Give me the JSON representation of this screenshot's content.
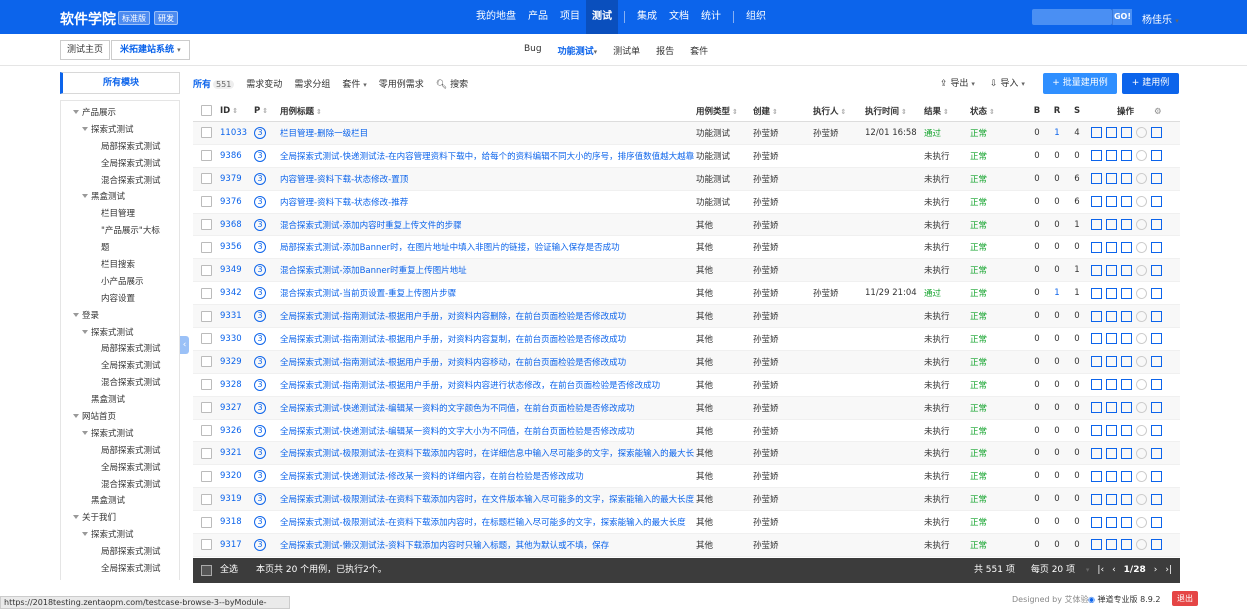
{
  "app": {
    "brand": "软件学院",
    "badges": [
      "标准版",
      "研发"
    ],
    "nav": [
      "我的地盘",
      "产品",
      "项目",
      "测试",
      "集成",
      "文档",
      "统计",
      "组织"
    ],
    "go_label": "GO!",
    "user": "杨佳乐"
  },
  "subbar": {
    "crumb_home": "测试主页",
    "crumb_product": "米拓建站系统",
    "tabs": [
      "Bug",
      "功能测试",
      "测试单",
      "报告",
      "套件"
    ]
  },
  "sidebar": {
    "title": "所有模块",
    "tree": [
      {
        "level": 0,
        "label": "产品展示",
        "expand": true
      },
      {
        "level": 1,
        "label": "探索式测试",
        "expand": true
      },
      {
        "level": 2,
        "label": "局部探索式测试"
      },
      {
        "level": 2,
        "label": "全局探索式测试"
      },
      {
        "level": 2,
        "label": "混合探索式测试"
      },
      {
        "level": 1,
        "label": "黑盒测试",
        "expand": true
      },
      {
        "level": 2,
        "label": "栏目管理"
      },
      {
        "level": 2,
        "label": "\"产品展示\"大标"
      },
      {
        "level": 2,
        "label": "题"
      },
      {
        "level": 2,
        "label": "栏目搜索"
      },
      {
        "level": 2,
        "label": "小产品展示"
      },
      {
        "level": 2,
        "label": "内容设置"
      },
      {
        "level": 0,
        "label": "登录",
        "expand": true
      },
      {
        "level": 1,
        "label": "探索式测试",
        "expand": true
      },
      {
        "level": 2,
        "label": "局部探索式测试"
      },
      {
        "level": 2,
        "label": "全局探索式测试"
      },
      {
        "level": 2,
        "label": "混合探索式测试"
      },
      {
        "level": 3,
        "label": "黑盒测试"
      },
      {
        "level": 0,
        "label": "网站首页",
        "expand": true
      },
      {
        "level": 1,
        "label": "探索式测试",
        "expand": true
      },
      {
        "level": 2,
        "label": "局部探索式测试"
      },
      {
        "level": 2,
        "label": "全局探索式测试"
      },
      {
        "level": 2,
        "label": "混合探索式测试"
      },
      {
        "level": 3,
        "label": "黑盒测试"
      },
      {
        "level": 0,
        "label": "关于我们",
        "expand": true
      },
      {
        "level": 1,
        "label": "探索式测试",
        "expand": true
      },
      {
        "level": 2,
        "label": "局部探索式测试"
      },
      {
        "level": 2,
        "label": "全局探索式测试"
      },
      {
        "level": 2,
        "label": "混合探索式测试"
      }
    ]
  },
  "toolbar": {
    "tabs": [
      {
        "label": "所有",
        "count": "551"
      },
      {
        "label": "需求变动"
      },
      {
        "label": "需求分组"
      },
      {
        "label": "套件",
        "dropdown": true
      },
      {
        "label": "零用例需求"
      },
      {
        "label": "搜索",
        "icon": "search-icon"
      }
    ],
    "export_label": "导出",
    "import_label": "导入",
    "batch_label": "+ 批量建用例",
    "new_label": "+ 建用例"
  },
  "table": {
    "headers": {
      "id": "ID",
      "p": "P",
      "title": "用例标题",
      "type": "用例类型",
      "creator": "创建",
      "executor": "执行人",
      "time": "执行时间",
      "result": "结果",
      "status": "状态",
      "b": "B",
      "r": "R",
      "s": "S",
      "ops": "操作"
    },
    "rows": [
      {
        "id": "11033",
        "p": "3",
        "title": "栏目管理-删除一级栏目",
        "type": "功能测试",
        "creator": "孙莹娇",
        "executor": "孙莹娇",
        "time": "12/01 16:58",
        "result": "通过",
        "status": "正常",
        "b": "0",
        "r": "1",
        "s": "4"
      },
      {
        "id": "9386",
        "p": "3",
        "title": "全局探索式测试-快递测试法-在内容管理资料下载中，给每个的资料编辑不同大小的序号，排序值数值越大越靠",
        "type": "功能测试",
        "creator": "孙莹娇",
        "executor": "",
        "time": "",
        "result": "未执行",
        "status": "正常",
        "b": "0",
        "r": "0",
        "s": "0"
      },
      {
        "id": "9379",
        "p": "3",
        "title": "内容管理-资料下载-状态修改-置顶",
        "type": "功能测试",
        "creator": "孙莹娇",
        "executor": "",
        "time": "",
        "result": "未执行",
        "status": "正常",
        "b": "0",
        "r": "0",
        "s": "6"
      },
      {
        "id": "9376",
        "p": "3",
        "title": "内容管理-资料下载-状态修改-推荐",
        "type": "功能测试",
        "creator": "孙莹娇",
        "executor": "",
        "time": "",
        "result": "未执行",
        "status": "正常",
        "b": "0",
        "r": "0",
        "s": "6"
      },
      {
        "id": "9368",
        "p": "3",
        "title": "混合探索式测试-添加内容时重复上传文件的步骤",
        "type": "其他",
        "creator": "孙莹娇",
        "executor": "",
        "time": "",
        "result": "未执行",
        "status": "正常",
        "b": "0",
        "r": "0",
        "s": "1"
      },
      {
        "id": "9356",
        "p": "3",
        "title": "局部探索式测试-添加Banner时，在图片地址中填入非图片的链接，验证输入保存是否成功",
        "type": "其他",
        "creator": "孙莹娇",
        "executor": "",
        "time": "",
        "result": "未执行",
        "status": "正常",
        "b": "0",
        "r": "0",
        "s": "0"
      },
      {
        "id": "9349",
        "p": "3",
        "title": "混合探索式测试-添加Banner时重复上传图片地址",
        "type": "其他",
        "creator": "孙莹娇",
        "executor": "",
        "time": "",
        "result": "未执行",
        "status": "正常",
        "b": "0",
        "r": "0",
        "s": "1"
      },
      {
        "id": "9342",
        "p": "3",
        "title": "混合探索式测试-当前页设置-重复上传图片步骤",
        "type": "其他",
        "creator": "孙莹娇",
        "executor": "孙莹娇",
        "time": "11/29 21:04",
        "result": "通过",
        "status": "正常",
        "b": "0",
        "r": "1",
        "s": "1"
      },
      {
        "id": "9331",
        "p": "3",
        "title": "全局探索式测试-指南测试法-根据用户手册，对资料内容删除，在前台页面检验是否修改成功",
        "type": "其他",
        "creator": "孙莹娇",
        "executor": "",
        "time": "",
        "result": "未执行",
        "status": "正常",
        "b": "0",
        "r": "0",
        "s": "0"
      },
      {
        "id": "9330",
        "p": "3",
        "title": "全局探索式测试-指南测试法-根据用户手册，对资料内容复制，在前台页面检验是否修改成功",
        "type": "其他",
        "creator": "孙莹娇",
        "executor": "",
        "time": "",
        "result": "未执行",
        "status": "正常",
        "b": "0",
        "r": "0",
        "s": "0"
      },
      {
        "id": "9329",
        "p": "3",
        "title": "全局探索式测试-指南测试法-根据用户手册，对资料内容移动，在前台页面检验是否修改成功",
        "type": "其他",
        "creator": "孙莹娇",
        "executor": "",
        "time": "",
        "result": "未执行",
        "status": "正常",
        "b": "0",
        "r": "0",
        "s": "0"
      },
      {
        "id": "9328",
        "p": "3",
        "title": "全局探索式测试-指南测试法-根据用户手册，对资料内容进行状态修改，在前台页面检验是否修改成功",
        "type": "其他",
        "creator": "孙莹娇",
        "executor": "",
        "time": "",
        "result": "未执行",
        "status": "正常",
        "b": "0",
        "r": "0",
        "s": "0"
      },
      {
        "id": "9327",
        "p": "3",
        "title": "全局探索式测试-快递测试法-编辑某一资料的文字颜色为不同值，在前台页面检验是否修改成功",
        "type": "其他",
        "creator": "孙莹娇",
        "executor": "",
        "time": "",
        "result": "未执行",
        "status": "正常",
        "b": "0",
        "r": "0",
        "s": "0"
      },
      {
        "id": "9326",
        "p": "3",
        "title": "全局探索式测试-快递测试法-编辑某一资料的文字大小为不同值，在前台页面检验是否修改成功",
        "type": "其他",
        "creator": "孙莹娇",
        "executor": "",
        "time": "",
        "result": "未执行",
        "status": "正常",
        "b": "0",
        "r": "0",
        "s": "0"
      },
      {
        "id": "9321",
        "p": "3",
        "title": "全局探索式测试-极限测试法-在资料下载添加内容时，在详细信息中输入尽可能多的文字，探索能输入的最大长",
        "type": "其他",
        "creator": "孙莹娇",
        "executor": "",
        "time": "",
        "result": "未执行",
        "status": "正常",
        "b": "0",
        "r": "0",
        "s": "0"
      },
      {
        "id": "9320",
        "p": "3",
        "title": "全局探索式测试-快递测试法-修改某一资料的详细内容，在前台检验是否修改成功",
        "type": "其他",
        "creator": "孙莹娇",
        "executor": "",
        "time": "",
        "result": "未执行",
        "status": "正常",
        "b": "0",
        "r": "0",
        "s": "0"
      },
      {
        "id": "9319",
        "p": "3",
        "title": "全局探索式测试-极限测试法-在资料下载添加内容时，在文件版本输入尽可能多的文字，探索能输入的最大长度",
        "type": "其他",
        "creator": "孙莹娇",
        "executor": "",
        "time": "",
        "result": "未执行",
        "status": "正常",
        "b": "0",
        "r": "0",
        "s": "0"
      },
      {
        "id": "9318",
        "p": "3",
        "title": "全局探索式测试-极限测试法-在资料下载添加内容时，在标题栏输入尽可能多的文字，探索能输入的最大长度",
        "type": "其他",
        "creator": "孙莹娇",
        "executor": "",
        "time": "",
        "result": "未执行",
        "status": "正常",
        "b": "0",
        "r": "0",
        "s": "0"
      },
      {
        "id": "9317",
        "p": "3",
        "title": "全局探索式测试-懒汉测试法-资料下载添加内容时只输入标题，其他为默认或不填，保存",
        "type": "其他",
        "creator": "孙莹娇",
        "executor": "",
        "time": "",
        "result": "未执行",
        "status": "正常",
        "b": "0",
        "r": "0",
        "s": "0"
      }
    ]
  },
  "footer": {
    "select_all": "全选",
    "summary": "本页共 20 个用例，已执行2个。",
    "total": "共 551 项",
    "per_page": "每页 20 项",
    "page": "1/28"
  },
  "statusbar": {
    "url": "https://2018testing.zentaopm.com/testcase-browse-3--byModule-136.html",
    "powered": "Designed by 艾体验",
    "version": "禅道专业版 8.9.2",
    "exit": "退出"
  }
}
